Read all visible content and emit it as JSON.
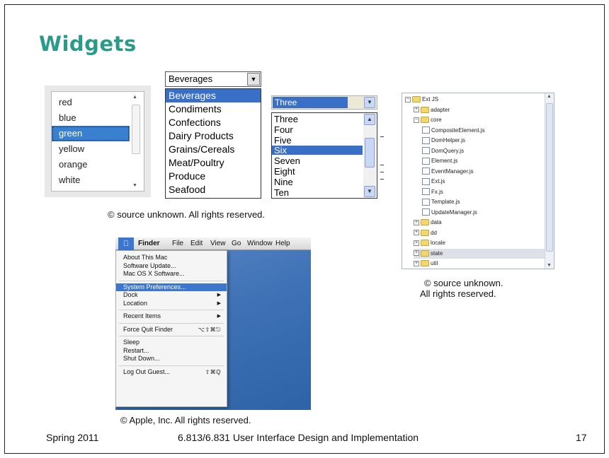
{
  "slide": {
    "title": "Widgets",
    "captions": {
      "top": "© source unknown. All rights reserved.",
      "tree_line1": "© source unknown.",
      "tree_line2": "All rights reserved.",
      "apple": "© Apple, Inc. All rights reserved."
    },
    "footer": {
      "left": "Spring 2011",
      "center": "6.813/6.831 User Interface Design and Implementation",
      "right": "17"
    }
  },
  "listbox": {
    "items": [
      "red",
      "blue",
      "green",
      "yellow",
      "orange",
      "white"
    ],
    "selected": "green"
  },
  "dropdown": {
    "value": "Beverages",
    "options": [
      "Beverages",
      "Condiments",
      "Confections",
      "Dairy Products",
      "Grains/Cereals",
      "Meat/Poultry",
      "Produce",
      "Seafood"
    ]
  },
  "combo2": {
    "value": "Three",
    "options": [
      "Three",
      "Four",
      "Five",
      "Six",
      "Seven",
      "Eight",
      "Nine",
      "Ten"
    ],
    "selected": "Six"
  },
  "tree": {
    "rows": [
      {
        "label": "Ext JS",
        "type": "folder",
        "toggle": "−",
        "depth": 0
      },
      {
        "label": "adapter",
        "type": "folder",
        "toggle": "+",
        "depth": 1
      },
      {
        "label": "core",
        "type": "folder",
        "toggle": "−",
        "depth": 1
      },
      {
        "label": "CompositeElement.js",
        "type": "file",
        "depth": 2
      },
      {
        "label": "DomHelper.js",
        "type": "file",
        "depth": 2
      },
      {
        "label": "DomQuery.js",
        "type": "file",
        "depth": 2
      },
      {
        "label": "Element.js",
        "type": "file",
        "depth": 2
      },
      {
        "label": "EventManager.js",
        "type": "file",
        "depth": 2
      },
      {
        "label": "Ext.js",
        "type": "file",
        "depth": 2
      },
      {
        "label": "Fx.js",
        "type": "file",
        "depth": 2
      },
      {
        "label": "Template.js",
        "type": "file",
        "depth": 2
      },
      {
        "label": "UpdateManager.js",
        "type": "file",
        "depth": 2
      },
      {
        "label": "data",
        "type": "folder",
        "toggle": "+",
        "depth": 1
      },
      {
        "label": "dd",
        "type": "folder",
        "toggle": "+",
        "depth": 1
      },
      {
        "label": "locale",
        "type": "folder",
        "toggle": "+",
        "depth": 1
      },
      {
        "label": "state",
        "type": "folder",
        "toggle": "+",
        "depth": 1,
        "selected": true
      },
      {
        "label": "util",
        "type": "folder",
        "toggle": "+",
        "depth": 1
      }
    ]
  },
  "macmenu": {
    "menubar": [
      "Finder",
      "File",
      "Edit",
      "View",
      "Go",
      "Window",
      "Help"
    ],
    "items": [
      {
        "label": "About This Mac"
      },
      {
        "label": "Software Update..."
      },
      {
        "label": "Mac OS X Software..."
      },
      {
        "sep": true
      },
      {
        "label": "System Preferences...",
        "selected": true
      },
      {
        "label": "Dock",
        "submenu": true
      },
      {
        "label": "Location",
        "submenu": true
      },
      {
        "sep": true
      },
      {
        "label": "Recent Items",
        "submenu": true
      },
      {
        "sep": true
      },
      {
        "label": "Force Quit Finder",
        "shortcut": "⌥⇧⌘⎋"
      },
      {
        "sep": true
      },
      {
        "label": "Sleep"
      },
      {
        "label": "Restart..."
      },
      {
        "label": "Shut Down..."
      },
      {
        "sep": true
      },
      {
        "label": "Log Out Guest...",
        "shortcut": "⇧⌘Q"
      }
    ]
  },
  "colors": {
    "title": "#2b9a88",
    "selection": "#3a6fc8",
    "mac_selection": "#3d76cf"
  }
}
